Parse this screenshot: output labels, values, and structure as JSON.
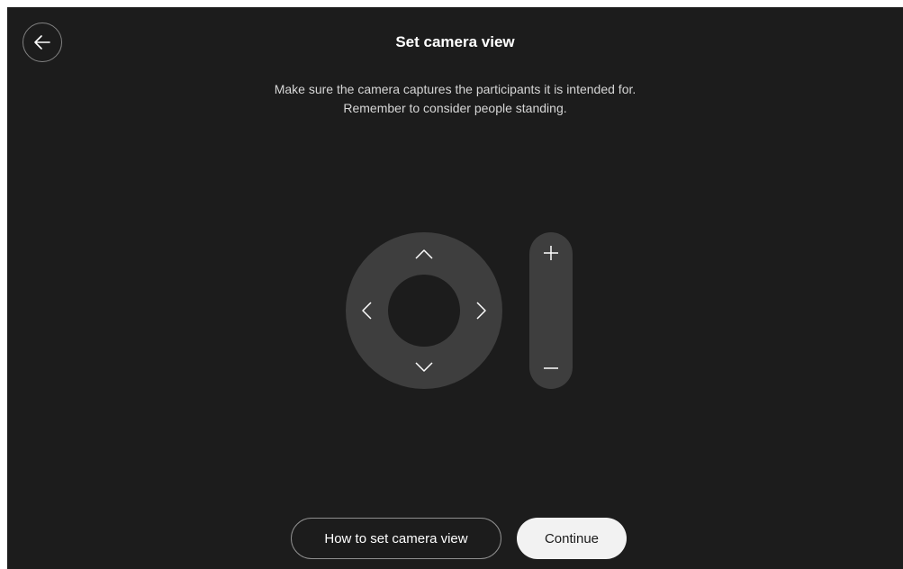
{
  "header": {
    "title": "Set camera view",
    "back_icon": "arrow-left-icon"
  },
  "instructions": {
    "line1": "Make sure the camera captures the participants it is intended for.",
    "line2": "Remember to consider people standing."
  },
  "camera_controls": {
    "pan_tilt_icons": [
      "chevron-up-icon",
      "chevron-down-icon",
      "chevron-left-icon",
      "chevron-right-icon"
    ],
    "zoom_icons": [
      "plus-icon",
      "minus-icon"
    ]
  },
  "footer": {
    "how_to_label": "How to set camera view",
    "continue_label": "Continue"
  },
  "colors": {
    "background": "#1c1c1c",
    "control_surface": "#3e3e3e",
    "text_primary": "#ffffff",
    "primary_button": "#f2f2f2"
  }
}
